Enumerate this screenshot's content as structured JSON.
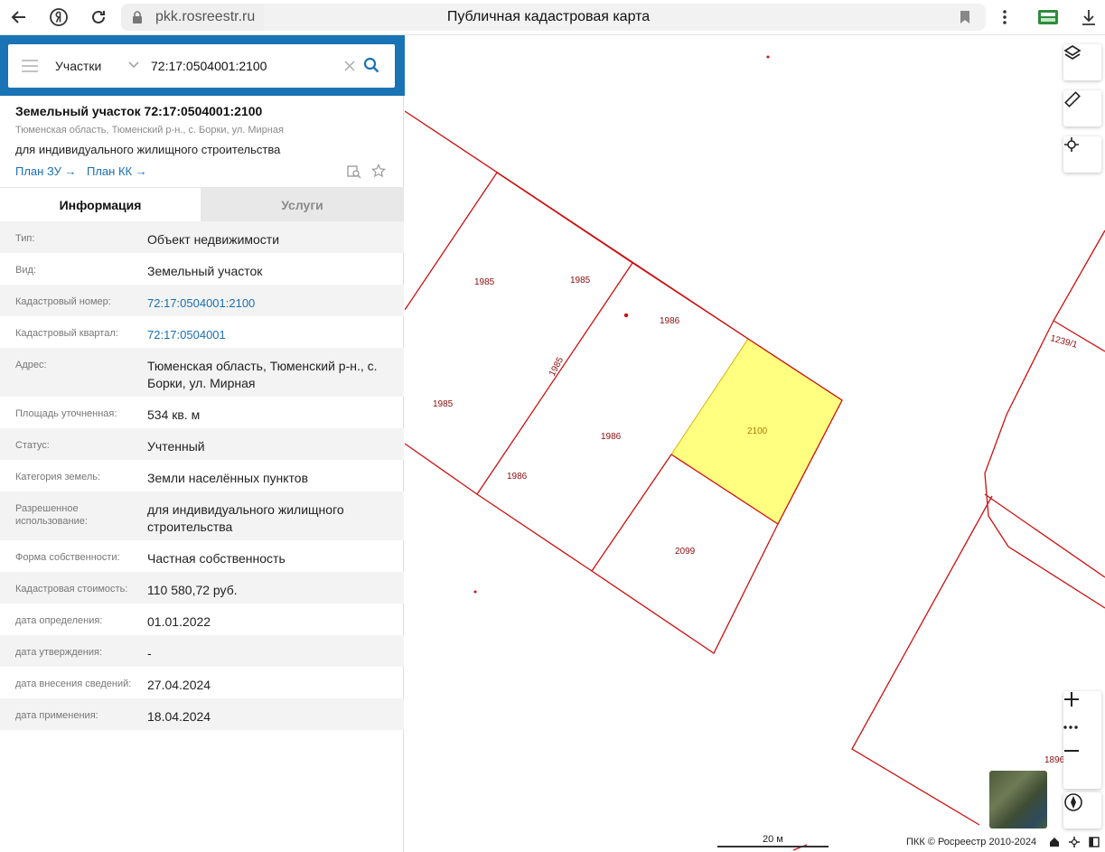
{
  "browser": {
    "url": "pkk.rosreestr.ru",
    "title": "Публичная кадастровая карта"
  },
  "search": {
    "category": "Участки",
    "query": "72:17:0504001:2100"
  },
  "object": {
    "title": "Земельный участок 72:17:0504001:2100",
    "address": "Тюменская область, Тюменский р-н., с. Борки, ул. Мирная",
    "use": "для индивидуального жилищного строительства",
    "link_plan_zu": "План ЗУ →",
    "link_plan_kk": "План КК →"
  },
  "tabs": {
    "info": "Информация",
    "services": "Услуги"
  },
  "info_rows": [
    {
      "label": "Тип:",
      "value": "Объект недвижимости"
    },
    {
      "label": "Вид:",
      "value": "Земельный участок"
    },
    {
      "label": "Кадастровый номер:",
      "value": "72:17:0504001:2100"
    },
    {
      "label": "Кадастровый квартал:",
      "value": "72:17:0504001"
    },
    {
      "label": "Адрес:",
      "value": "Тюменская область, Тюменский р-н., с. Борки, ул. Мирная"
    },
    {
      "label": "Площадь уточненная:",
      "value": "534 кв. м"
    },
    {
      "label": "Статус:",
      "value": "Учтенный"
    },
    {
      "label": "Категория земель:",
      "value": "Земли населённых пунктов"
    },
    {
      "label": "Разрешенное использование:",
      "value": "для индивидуального жилищного строительства"
    },
    {
      "label": "Форма собственности:",
      "value": "Частная собственность"
    },
    {
      "label": "Кадастровая стоимость:",
      "value": "110 580,72 руб."
    },
    {
      "label": "дата определения:",
      "value": "01.01.2022"
    },
    {
      "label": "дата утверждения:",
      "value": "-"
    },
    {
      "label": "дата внесения сведений:",
      "value": "27.04.2024"
    },
    {
      "label": "дата применения:",
      "value": "18.04.2024"
    }
  ],
  "map": {
    "parcel_labels": [
      "1985",
      "1985",
      "1985",
      "1985",
      "1986",
      "1986",
      "1986",
      "2100",
      "2099",
      "1239/1",
      "1896"
    ],
    "scale": "20 м",
    "copyright": "ПКК © Росреестр 2010-2024",
    "highlight_color": "#ffff80",
    "boundary_color": "#cc1111"
  }
}
